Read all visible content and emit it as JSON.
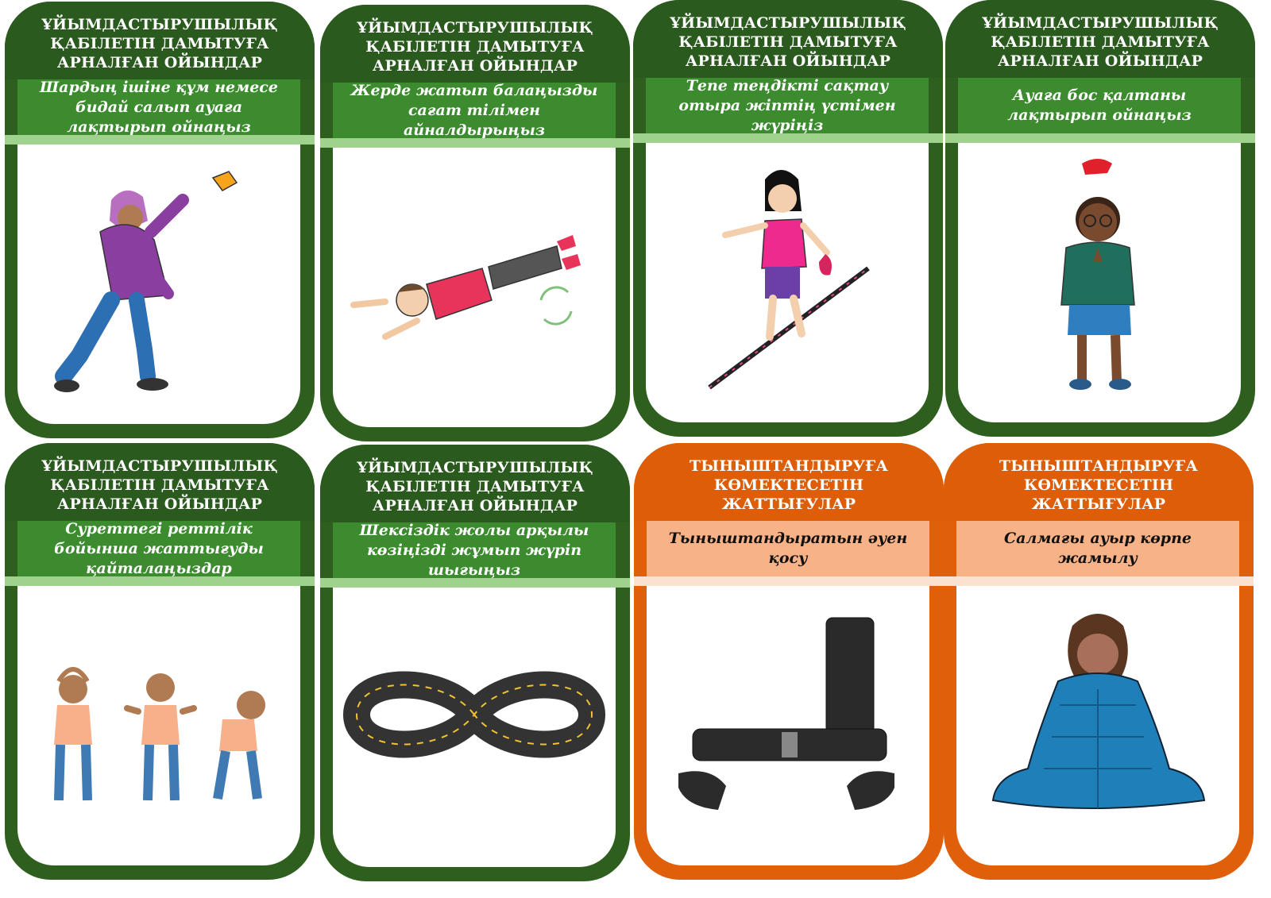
{
  "cards": [
    {
      "header": "ҰЙЫМДАСТЫРУШЫЛЫҚ ҚАБІЛЕТІН ДАМЫТУҒА АРНАЛҒАН ОЙЫНДАР",
      "instruction": "Шардың ішіне құм немесе бидай салып ауаға лақтырып ойнаңыз",
      "icon": "child-throwing-beanbag-icon"
    },
    {
      "header": "ҰЙЫМДАСТЫРУШЫЛЫҚ ҚАБІЛЕТІН ДАМЫТУҒА АРНАЛҒАН ОЙЫНДАР",
      "instruction": "Жерде жатып балаңызды сағат тілімен айналдырыңыз",
      "icon": "child-lying-rotating-icon"
    },
    {
      "header": "ҰЙЫМДАСТЫРУШЫЛЫҚ ҚАБІЛЕТІН ДАМЫТУҒА АРНАЛҒАН ОЙЫНДАР",
      "instruction": "Тепе теңдікті сақтау отыра жіптің үстімен жүріңіз",
      "icon": "girl-balancing-rope-icon"
    },
    {
      "header": "ҰЙЫМДАСТЫРУШЫЛЫҚ ҚАБІЛЕТІН ДАМЫТУҒА АРНАЛҒАН ОЙЫНДАР",
      "instruction": "Ауаға бос қалтаны лақтырып ойнаңыз",
      "icon": "boy-catching-bag-icon"
    },
    {
      "header": "ҰЙЫМДАСТЫРУШЫЛЫҚ ҚАБІЛЕТІН ДАМЫТУҒА АРНАЛҒАН ОЙЫНДАР",
      "instruction": "Суреттегі реттілік бойынша жаттығуды қайталаңыздар",
      "icon": "exercise-sequence-icon"
    },
    {
      "header": "ҰЙЫМДАСТЫРУШЫЛЫҚ ҚАБІЛЕТІН ДАМЫТУҒА АРНАЛҒАН ОЙЫНДАР",
      "instruction": "Шексіздік жолы арқылы көзіңізді жұмып жүріп шығыңыз",
      "icon": "infinity-road-icon"
    },
    {
      "header": "ТЫНЫШТАНДЫРУҒА КӨМЕКТЕСЕТІН ЖАТТЫҒУЛАР",
      "instruction": "Тыныштандыратын әуен қосу",
      "icon": "speaker-system-icon"
    },
    {
      "header": "ТЫНЫШТАНДЫРУҒА КӨМЕКТЕСЕТІН ЖАТТЫҒУЛАР",
      "instruction": "Салмағы ауыр көрпе жамылу",
      "icon": "girl-weighted-blanket-icon"
    }
  ],
  "colors": {
    "dark_green": "#2a5a1d",
    "mid_green": "#3c8b2f",
    "light_green": "#9fd28d",
    "orange": "#de5d08",
    "peach": "#f7b287"
  }
}
